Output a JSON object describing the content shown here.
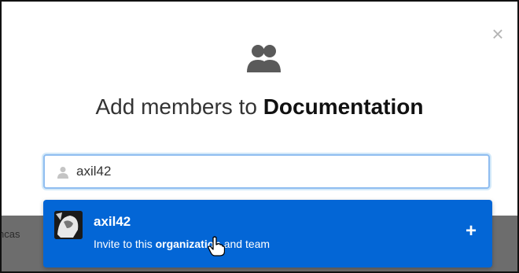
{
  "modal": {
    "title_prefix": "Add members to ",
    "title_team": "Documentation",
    "close_glyph": "×",
    "icon": "people-icon"
  },
  "search": {
    "value": "axil42",
    "icon": "person-icon"
  },
  "suggestion": {
    "username": "axil42",
    "sub_prefix": "Invite to this ",
    "sub_bold": "organization",
    "sub_suffix": " and team",
    "action_glyph": "+"
  },
  "backdrop": {
    "partial_text": "ncas"
  },
  "colors": {
    "accent": "#0366d6",
    "focus_border": "#8fbdf0",
    "backdrop": "#6d6d6d"
  }
}
